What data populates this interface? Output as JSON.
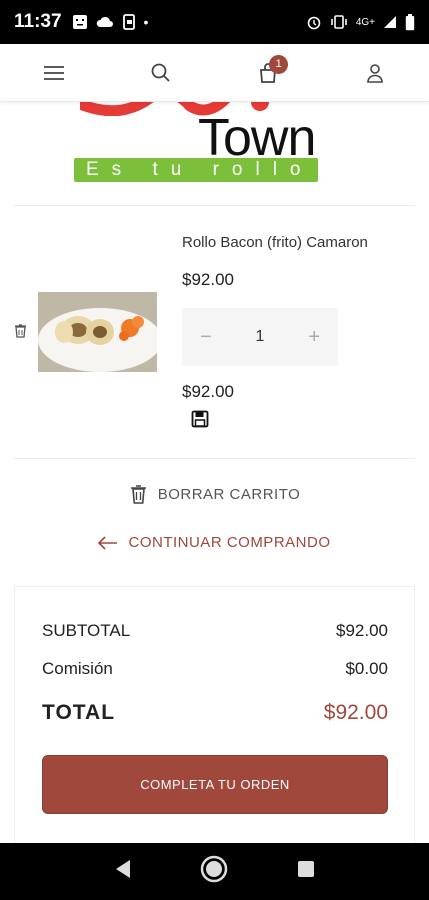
{
  "status_bar": {
    "time": "11:37",
    "network_label": "4G+",
    "left_icons": [
      "face-icon",
      "cloud-icon",
      "screen-icon",
      "dot-icon"
    ],
    "right_icons": [
      "alarm-icon",
      "vibrate-icon",
      "signal-icon",
      "battery-icon"
    ]
  },
  "header": {
    "cart_badge_count": "1",
    "icons": [
      "menu-icon",
      "search-icon",
      "cart-icon",
      "user-icon"
    ]
  },
  "logo": {
    "word": "Town",
    "tagline": "Es tu rollo"
  },
  "cart_item": {
    "name": "Rollo Bacon (frito) Camaron",
    "unit_price": "$92.00",
    "quantity": "1",
    "minus_symbol": "−",
    "plus_symbol": "+",
    "line_total": "$92.00"
  },
  "actions": {
    "clear_cart_label": "BORRAR CARRITO",
    "continue_shopping_label": "CONTINUAR COMPRANDO"
  },
  "summary": {
    "subtotal_label": "SUBTOTAL",
    "subtotal_value": "$92.00",
    "commission_label": "Comisión",
    "commission_value": "$0.00",
    "total_label": "TOTAL",
    "total_value": "$92.00",
    "checkout_label": "COMPLETA TU ORDEN"
  },
  "colors": {
    "accent": "#a0483c",
    "logo_green": "#7cbf3a"
  }
}
